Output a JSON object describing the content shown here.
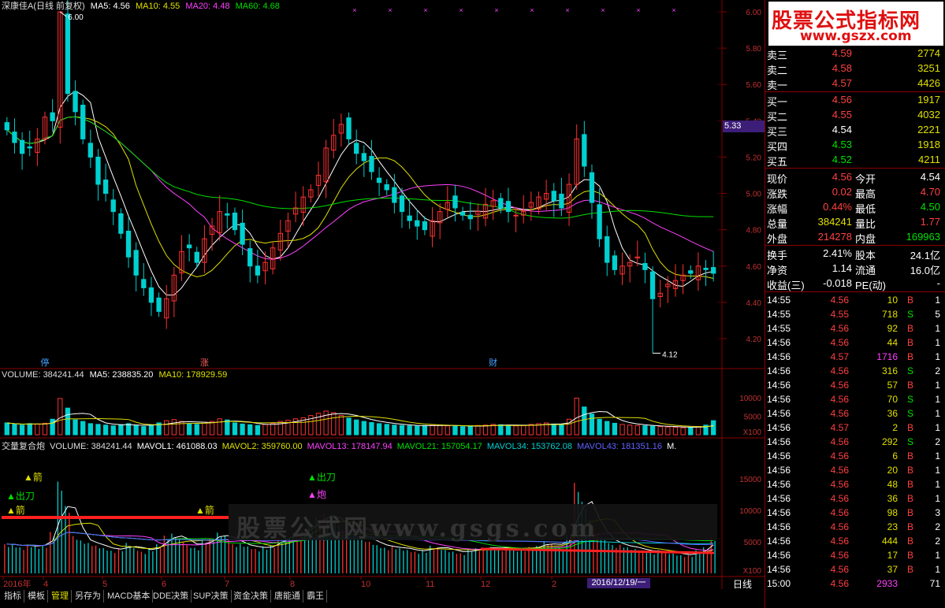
{
  "header": {
    "main": {
      "title": "深康佳A(日线 前复权)",
      "ma5": "MA5: 4.56",
      "ma10": "MA10: 4.55",
      "ma20": "MA20: 4.48",
      "ma60": "MA60: 4.68"
    },
    "vol": {
      "volume": "VOLUME: 384241.44",
      "ma5": "MA5: 238835.20",
      "ma10": "MA10: 178929.59"
    },
    "ind": {
      "name": "交量复合炮",
      "volume": "VOLUME: 384241.44",
      "mavol1": "MAVOL1: 461088.03",
      "mavol2": "MAVOL2: 359760.00",
      "mavol13": "MAVOL13: 178147.94",
      "mavol21": "MAVOL21: 157054.17",
      "mavol34": "MAVOL34: 153762.08",
      "mavol43": "MAVOL43: 181351.16",
      "more": "M."
    }
  },
  "colors": {
    "up": "#ff3030",
    "down": "#00d0d0",
    "ma5": "#ffffff",
    "ma10": "#e0e000",
    "ma20": "#ff40ff",
    "ma60": "#00e000",
    "bg": "#000000",
    "grid": "#8a0000"
  },
  "chart_data": [
    {
      "type": "candlestick",
      "title": "深康佳A(日线 前复权)",
      "ylim": [
        4.1,
        6.05
      ],
      "yticks": [
        "6.00",
        "5.80",
        "5.60",
        "5.40",
        "5.20",
        "5.00",
        "4.80",
        "4.60",
        "4.40",
        "4.20"
      ],
      "current_price_tag": "5.33",
      "annotations": {
        "high": "6.00",
        "low": "4.12",
        "markers": [
          "停",
          "涨",
          "财"
        ]
      },
      "close": [
        5.35,
        5.28,
        5.22,
        5.25,
        5.3,
        5.42,
        5.4,
        6.0,
        5.55,
        5.45,
        5.3,
        5.2,
        5.05,
        5.0,
        4.9,
        4.78,
        4.65,
        4.55,
        4.48,
        4.4,
        4.35,
        4.42,
        4.55,
        4.68,
        4.7,
        4.62,
        4.75,
        4.82,
        4.9,
        4.88,
        4.8,
        4.72,
        4.6,
        4.55,
        4.62,
        4.7,
        4.78,
        4.85,
        4.92,
        4.98,
        5.02,
        5.1,
        5.25,
        5.32,
        5.38,
        5.3,
        5.22,
        5.18,
        5.12,
        5.06,
        5.02,
        4.95,
        4.9,
        4.85,
        4.82,
        4.8,
        4.85,
        4.9,
        4.95,
        4.92,
        4.88,
        4.86,
        4.9,
        4.94,
        4.96,
        4.92,
        4.9,
        4.88,
        4.9,
        4.95,
        4.98,
        5.0,
        4.96,
        4.92,
        5.05,
        5.3,
        5.15,
        4.95,
        4.75,
        4.62,
        4.58,
        4.6,
        4.62,
        4.65,
        4.58,
        4.42,
        4.45,
        4.5,
        4.52,
        4.55,
        4.56,
        4.6,
        4.58,
        4.56
      ],
      "ma5": "",
      "ma10": "",
      "ma20": "",
      "ma60": ""
    },
    {
      "type": "bar",
      "title": "VOLUME",
      "yticks": [
        "10000",
        "5000",
        "X100"
      ],
      "values": [
        3200,
        2800,
        2600,
        3000,
        2900,
        3100,
        4200,
        9800,
        7200,
        4000,
        3600,
        3000,
        2800,
        2600,
        2400,
        2700,
        3000,
        2500,
        2200,
        2600,
        3200,
        3800,
        4100,
        3600,
        3000,
        2800,
        3400,
        3600,
        4300,
        4000,
        3200,
        2900,
        2700,
        2500,
        2800,
        3100,
        3600,
        3900,
        4300,
        4600,
        5200,
        5800,
        6400,
        6000,
        5200,
        4500,
        4000,
        3600,
        3300,
        3000,
        2800,
        2600,
        2500,
        2400,
        2300,
        2500,
        2700,
        2600,
        2400,
        2300,
        2200,
        2300,
        2500,
        2600,
        2800,
        2700,
        2500,
        2400,
        2500,
        2800,
        3000,
        3200,
        2900,
        2700,
        4200,
        9900,
        7500,
        5600,
        4200,
        3600,
        3100,
        2800,
        2600,
        2500,
        2400,
        2300,
        2200,
        2100,
        2000,
        1900,
        2000,
        2200,
        2600,
        3800
      ]
    },
    {
      "type": "bar",
      "title": "交量复合炮",
      "yticks": [
        "15000",
        "10000",
        "5000",
        "X100"
      ],
      "signals": [
        "箭",
        "出刀",
        "箭",
        "箭",
        "出刀",
        "炮"
      ]
    }
  ],
  "x_axis": {
    "labels": [
      "2016年",
      "4",
      "5",
      "6",
      "7",
      "8",
      "10",
      "11",
      "12",
      "2"
    ],
    "cursor_date": "2016/12/19/一",
    "period": "日线"
  },
  "watermark": "股票公式网www.gsgs.com",
  "quote": {
    "logo_line1": "股票公式指标网",
    "logo_line2": "www.gszx.com",
    "asks": [
      {
        "label": "卖三",
        "price": "4.59",
        "vol": "2774"
      },
      {
        "label": "卖二",
        "price": "4.58",
        "vol": "3251"
      },
      {
        "label": "卖一",
        "price": "4.57",
        "vol": "4426"
      }
    ],
    "bids": [
      {
        "label": "买一",
        "price": "4.56",
        "vol": "1917"
      },
      {
        "label": "买二",
        "price": "4.55",
        "vol": "4032"
      },
      {
        "label": "买三",
        "price": "4.54",
        "vol": "2221"
      },
      {
        "label": "买四",
        "price": "4.53",
        "vol": "1918"
      },
      {
        "label": "买五",
        "price": "4.52",
        "vol": "4211"
      }
    ],
    "stats": [
      {
        "l1": "现价",
        "v1": "4.56",
        "l2": "今开",
        "v2": "4.54"
      },
      {
        "l1": "涨跌",
        "v1": "0.02",
        "l2": "最高",
        "v2": "4.70"
      },
      {
        "l1": "涨幅",
        "v1": "0.44%",
        "l2": "最低",
        "v2": "4.50"
      },
      {
        "l1": "总量",
        "v1": "384241",
        "l2": "量比",
        "v2": "1.77"
      },
      {
        "l1": "外盘",
        "v1": "214278",
        "l2": "内盘",
        "v2": "169963"
      }
    ],
    "stats2": [
      {
        "l1": "换手",
        "v1": "2.41%",
        "l2": "股本",
        "v2": "24.1亿"
      },
      {
        "l1": "净资",
        "v1": "1.14",
        "l2": "流通",
        "v2": "16.0亿"
      },
      {
        "l1": "收益(三)",
        "v1": "-0.018",
        "l2": "PE(动)",
        "v2": "-"
      }
    ],
    "ticks": [
      {
        "t": "14:55",
        "p": "4.56",
        "v": "10",
        "d": "B",
        "n": "1"
      },
      {
        "t": "14:55",
        "p": "4.55",
        "v": "718",
        "d": "S",
        "n": "5"
      },
      {
        "t": "14:55",
        "p": "4.56",
        "v": "92",
        "d": "B",
        "n": "1"
      },
      {
        "t": "14:56",
        "p": "4.56",
        "v": "44",
        "d": "B",
        "n": "1"
      },
      {
        "t": "14:56",
        "p": "4.57",
        "v": "1716",
        "d": "B",
        "n": "1"
      },
      {
        "t": "14:56",
        "p": "4.56",
        "v": "316",
        "d": "S",
        "n": "2"
      },
      {
        "t": "14:56",
        "p": "4.56",
        "v": "57",
        "d": "B",
        "n": "1"
      },
      {
        "t": "14:56",
        "p": "4.56",
        "v": "70",
        "d": "S",
        "n": "1"
      },
      {
        "t": "14:56",
        "p": "4.56",
        "v": "36",
        "d": "S",
        "n": "1"
      },
      {
        "t": "14:56",
        "p": "4.57",
        "v": "2",
        "d": "B",
        "n": "1"
      },
      {
        "t": "14:56",
        "p": "4.56",
        "v": "292",
        "d": "S",
        "n": "2"
      },
      {
        "t": "14:56",
        "p": "4.56",
        "v": "6",
        "d": "B",
        "n": "1"
      },
      {
        "t": "14:56",
        "p": "4.56",
        "v": "20",
        "d": "B",
        "n": "1"
      },
      {
        "t": "14:56",
        "p": "4.56",
        "v": "48",
        "d": "B",
        "n": "1"
      },
      {
        "t": "14:56",
        "p": "4.56",
        "v": "36",
        "d": "B",
        "n": "1"
      },
      {
        "t": "14:56",
        "p": "4.56",
        "v": "98",
        "d": "B",
        "n": "3"
      },
      {
        "t": "14:56",
        "p": "4.56",
        "v": "23",
        "d": "B",
        "n": "2"
      },
      {
        "t": "14:56",
        "p": "4.56",
        "v": "444",
        "d": "B",
        "n": "2"
      },
      {
        "t": "14:56",
        "p": "4.56",
        "v": "17",
        "d": "B",
        "n": "1"
      },
      {
        "t": "14:56",
        "p": "4.56",
        "v": "37",
        "d": "B",
        "n": "1"
      },
      {
        "t": "15:00",
        "p": "4.56",
        "v": "2933",
        "d": "",
        "n": "71"
      }
    ]
  },
  "tabs": [
    "指标",
    "模板",
    "管理",
    "另存为",
    "MACD基本",
    "DDE决策",
    "SUP决策",
    "资金决策",
    "唐能通",
    "霸王"
  ]
}
